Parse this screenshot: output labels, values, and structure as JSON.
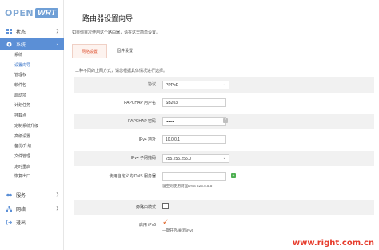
{
  "logo": {
    "open": "OPEN",
    "wrt": "WRT"
  },
  "sidebar": {
    "items": [
      {
        "label": "状态",
        "icon": "dashboard-icon"
      },
      {
        "label": "系统",
        "icon": "gear-icon"
      }
    ],
    "system_sub": [
      "系统",
      "设置向导",
      "管理权",
      "软件包",
      "启动项",
      "计划任务",
      "挂载点",
      "定制系统升级",
      "高级设置",
      "备份/升级",
      "文件管理",
      "定时重启",
      "恢复出厂"
    ],
    "bottom_items": [
      {
        "label": "服务",
        "icon": "services-icon"
      },
      {
        "label": "网络",
        "icon": "network-icon"
      },
      {
        "label": "退出",
        "icon": "logout-icon"
      }
    ]
  },
  "page": {
    "title": "路由器设置向导",
    "description": "如果你首次使用这个路由器，请在这里简单设置。",
    "tabs": [
      "网络设置",
      "固件设置"
    ],
    "hint": "二种不同的上网方式，请您根据具体情况进行选择。"
  },
  "form": {
    "protocol_label": "协议",
    "protocol_value": "PPPoE",
    "username_label": "PAPCHAP 用户名",
    "username_value": "SB203",
    "password_label": "PAPCHAP 密码",
    "password_value": "••••••",
    "ip_label": "IPv4 地址",
    "ip_value": "10.0.0.1",
    "mask_label": "IPv4 子网掩码",
    "mask_value": "255.255.255.0",
    "dns_label": "使用自定义的 DNS 服务器",
    "dns_value": "",
    "dns_note": "留空则使用阿里DNS 223.5.5.5",
    "bypass_label": "旁路由模式",
    "bypass_checked": false,
    "ipv6_label": "启用 iPv6",
    "ipv6_checked": true,
    "ipv6_note": "一键开启/关闭 iPv6"
  },
  "watermark": "www.right.com.cn",
  "colors": {
    "accent": "#5b8fd6",
    "tab_active": "#e05a3a",
    "add_button": "#4caf50",
    "watermark": "#e63b2b"
  }
}
